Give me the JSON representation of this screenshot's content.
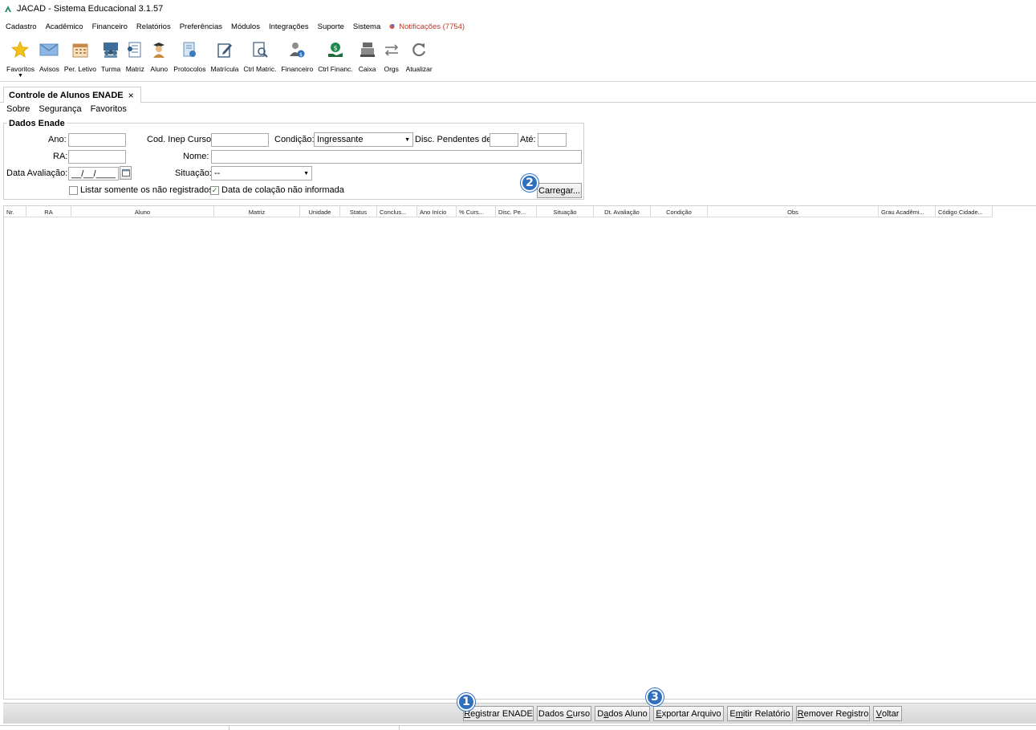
{
  "window": {
    "title": "JACAD - Sistema Educacional 3.1.57"
  },
  "menu": {
    "items": [
      "Cadastro",
      "Acadêmico",
      "Financeiro",
      "Relatórios",
      "Preferências",
      "Módulos",
      "Integrações",
      "Suporte",
      "Sistema"
    ],
    "notifications": "Notificações (7754)"
  },
  "toolbar": {
    "items": [
      {
        "label": "Favoritos",
        "icon": "star-icon"
      },
      {
        "label": "Avisos",
        "icon": "envelope-icon"
      },
      {
        "label": "Per. Letivo",
        "icon": "calendar-icon"
      },
      {
        "label": "Turma",
        "icon": "group-icon"
      },
      {
        "label": "Matriz",
        "icon": "document-list-icon"
      },
      {
        "label": "Aluno",
        "icon": "student-icon"
      },
      {
        "label": "Protocolos",
        "icon": "protocol-icon"
      },
      {
        "label": "Matrícula",
        "icon": "edit-document-icon"
      },
      {
        "label": "Ctrl Matric.",
        "icon": "search-document-icon"
      },
      {
        "label": "Financeiro",
        "icon": "user-money-icon"
      },
      {
        "label": "Ctrl Financ.",
        "icon": "money-hand-icon"
      },
      {
        "label": "Caixa",
        "icon": "cash-register-icon"
      },
      {
        "label": "Orgs",
        "icon": "swap-arrows-icon"
      },
      {
        "label": "Atualizar",
        "icon": "refresh-icon"
      }
    ]
  },
  "tab": {
    "title": "Controle de Alunos ENADE",
    "close": "×"
  },
  "submenu": [
    "Sobre",
    "Segurança",
    "Favoritos"
  ],
  "form": {
    "group_title": "Dados Enade",
    "ano_label": "Ano:",
    "ano_value": "",
    "cod_inep_label": "Cod. Inep Curso:",
    "cod_inep_value": "",
    "condicao_label": "Condição:",
    "condicao_value": "Ingressante",
    "disc_pend_label": "Disc. Pendentes de:",
    "disc_pend_value": "",
    "ate_label": "Até:",
    "ate_value": "",
    "ra_label": "RA:",
    "ra_value": "",
    "nome_label": "Nome:",
    "nome_value": "",
    "data_aval_label": "Data Avaliação:",
    "data_aval_value": "__/__/____",
    "situacao_label": "Situação:",
    "situacao_value": "--",
    "listar_label": "Listar somente os não registrados",
    "listar_checked": false,
    "colacao_label": "Data de colação não informada",
    "colacao_checked": true,
    "carregar_label": "Carregar..."
  },
  "grid": {
    "columns": [
      "Nr.",
      "RA",
      "Aluno",
      "Matriz",
      "Unidade",
      "Status",
      "Conclus...",
      "Ano Início",
      "% Curs...",
      "Disc. Pe...",
      "Situação",
      "Dt. Avaliação",
      "Condição",
      "Obs",
      "Grau Acadêmi...",
      "Código Cidade..."
    ],
    "rows": []
  },
  "badges": [
    "1",
    "2",
    "3"
  ],
  "actions": {
    "registrar": {
      "pre": "",
      "u": "R",
      "post": "egistrar ENADE"
    },
    "dados_curso": {
      "pre": "Dados ",
      "u": "C",
      "post": "urso"
    },
    "dados_aluno": {
      "pre": "D",
      "u": "a",
      "post": "dos Aluno"
    },
    "exportar": {
      "pre": "",
      "u": "E",
      "post": "xportar Arquivo"
    },
    "emitir": {
      "pre": "E",
      "u": "m",
      "post": "itir Relatório"
    },
    "remover": {
      "pre": "",
      "u": "R",
      "post": "emover Registro"
    },
    "voltar": {
      "pre": "",
      "u": "V",
      "post": "oltar"
    }
  }
}
